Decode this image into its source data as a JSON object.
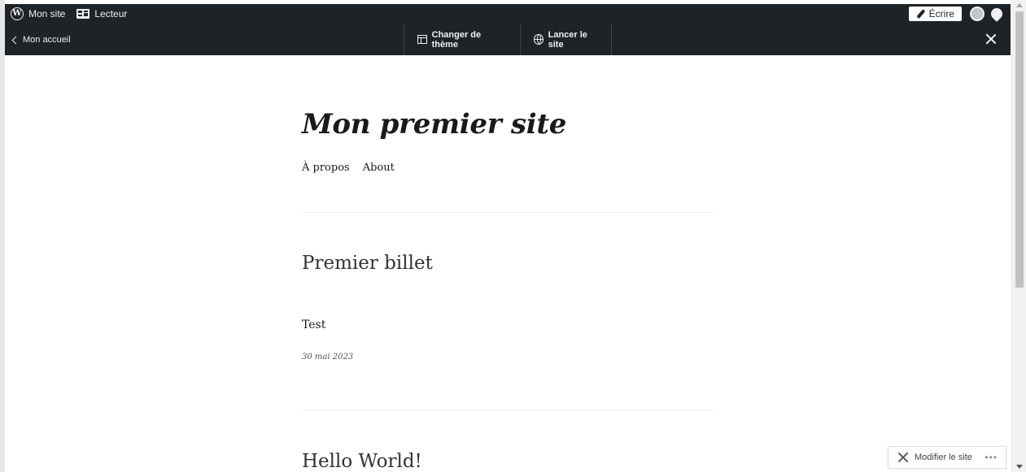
{
  "adminbar": {
    "my_site": "Mon site",
    "reader": "Lecteur",
    "write": "Écrire"
  },
  "toolbar": {
    "back": "Mon accueil",
    "change_theme": "Changer de thème",
    "launch_site": "Lancer le site"
  },
  "site": {
    "title": "Mon premier site",
    "nav": [
      "À propos",
      "About"
    ],
    "posts": [
      {
        "title": "Premier billet",
        "excerpt": "Test",
        "date": "30 mai 2023"
      },
      {
        "title": "Hello World!"
      }
    ]
  },
  "floating": {
    "modify_site": "Modifier le site",
    "more": "•••"
  }
}
